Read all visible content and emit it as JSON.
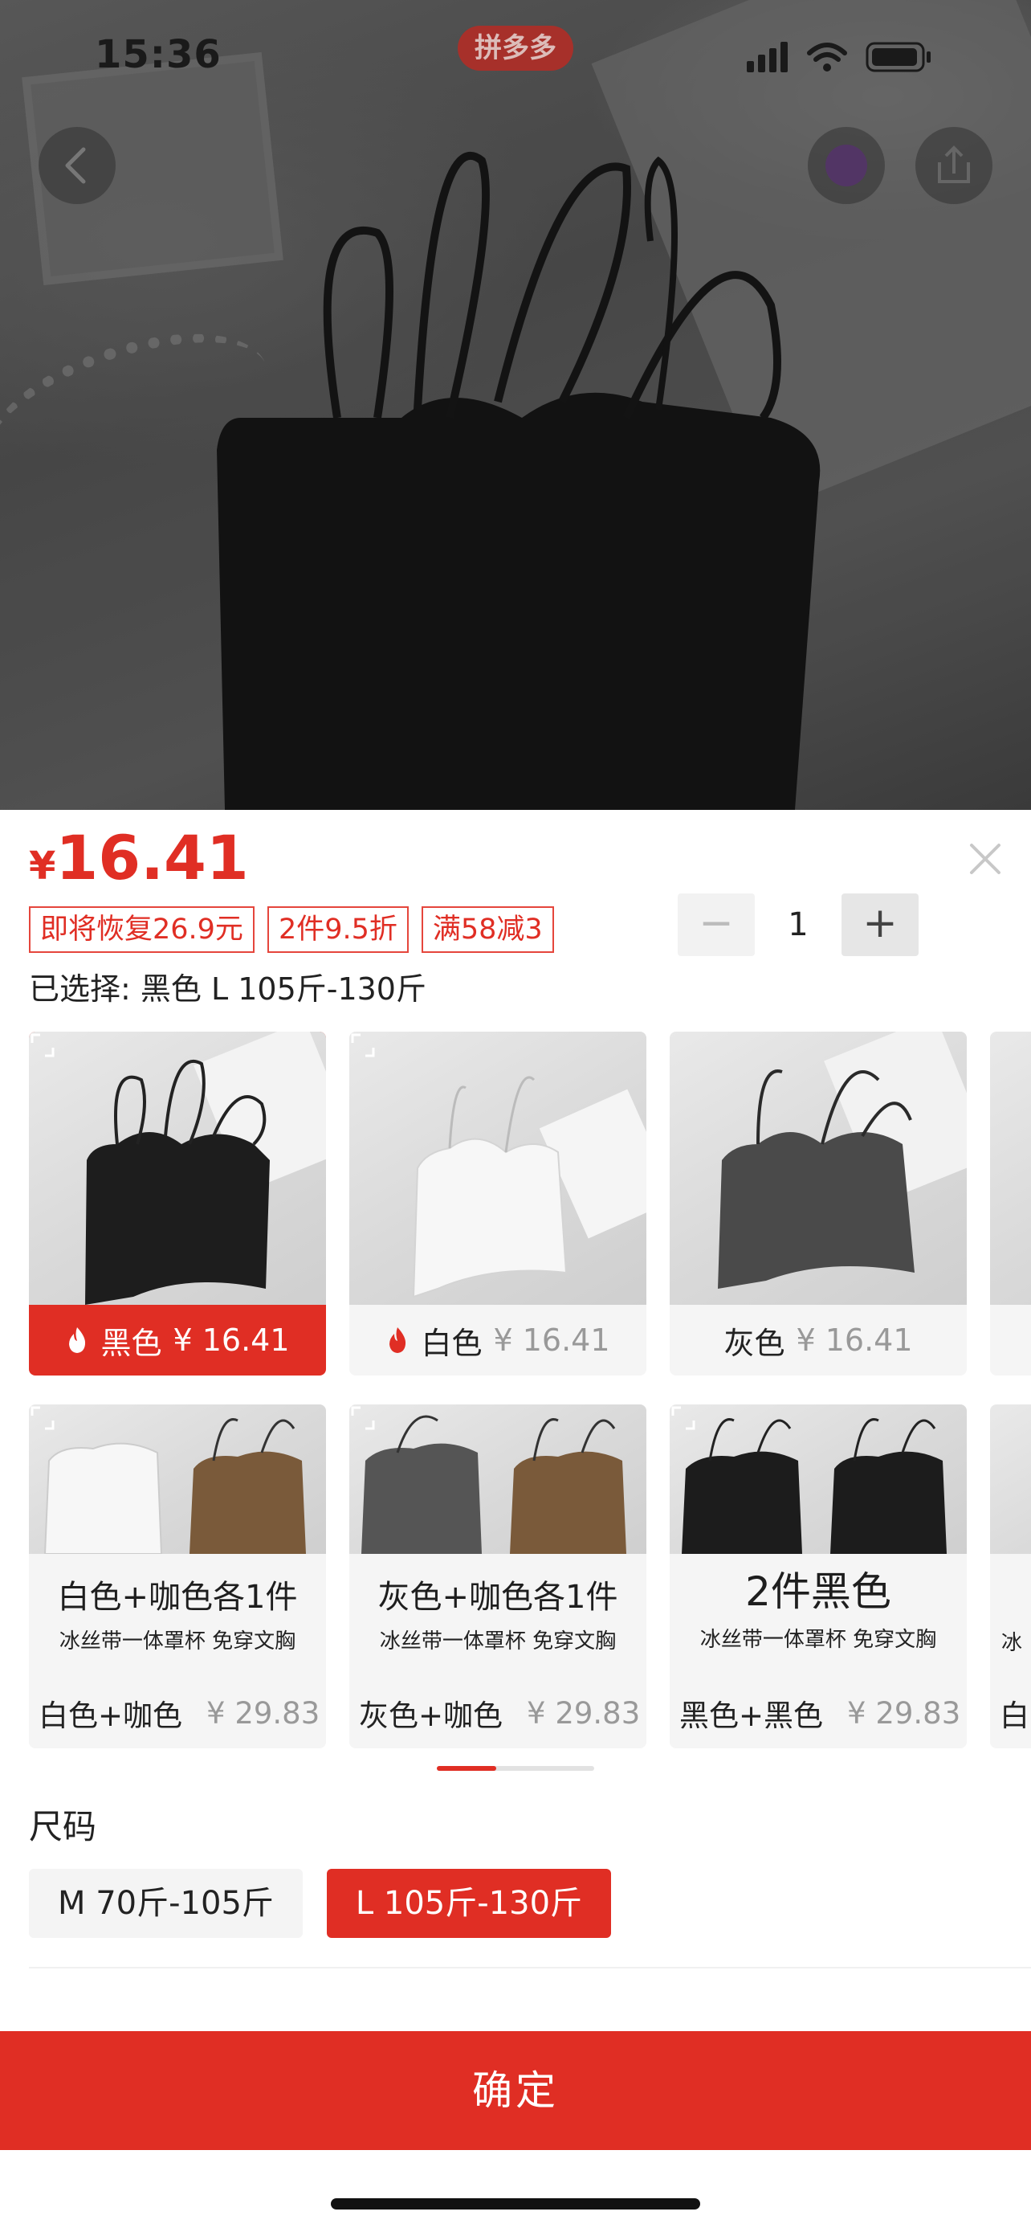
{
  "status_bar": {
    "time": "15:36",
    "app_badge": "拼多多"
  },
  "product": {
    "currency": "¥",
    "price": "16.41",
    "tags": [
      "即将恢复26.9元",
      "2件9.5折",
      "满58减3"
    ],
    "selected_text": "已选择: 黑色 L 105斤-130斤"
  },
  "quantity": {
    "minus": "−",
    "value": "1",
    "plus": "+"
  },
  "colors": [
    {
      "name": "黑色",
      "price": "¥ 16.41",
      "hot": true,
      "selected": true
    },
    {
      "name": "白色",
      "price": "¥ 16.41",
      "hot": true,
      "selected": false
    },
    {
      "name": "灰色",
      "price": "¥ 16.41",
      "hot": false,
      "selected": false
    }
  ],
  "bundles": [
    {
      "headline": "白色+咖色各1件",
      "sub": "冰丝带一体罩杯 免穿文胸",
      "name": "白色+咖色",
      "price": "¥ 29.83"
    },
    {
      "headline": "灰色+咖色各1件",
      "sub": "冰丝带一体罩杯 免穿文胸",
      "name": "灰色+咖色",
      "price": "¥ 29.83"
    },
    {
      "headline": "2件黑色",
      "sub": "冰丝带一体罩杯 免穿文胸",
      "name": "黑色+黑色",
      "price": "¥ 29.83"
    }
  ],
  "peek": {
    "top_label": "",
    "bottom_label": "白",
    "bottom_sub": "冰"
  },
  "size": {
    "title": "尺码",
    "options": [
      {
        "label": "M 70斤-105斤",
        "selected": false
      },
      {
        "label": "L 105斤-130斤",
        "selected": true
      }
    ]
  },
  "confirm_label": "确定",
  "colors_theme": {
    "accent": "#e02e24",
    "dim_bg": "#4e4e4e"
  }
}
